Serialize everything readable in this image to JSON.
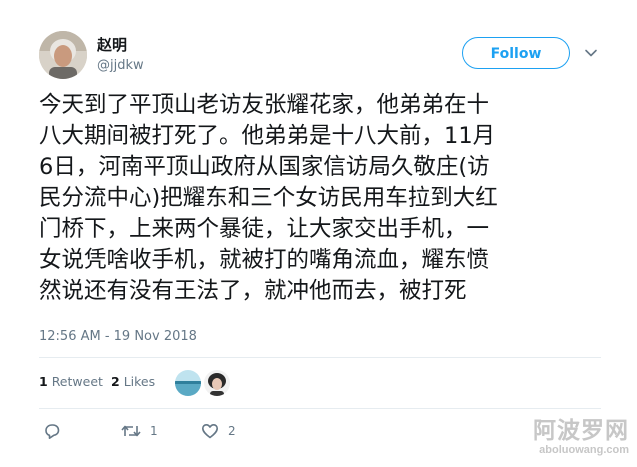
{
  "user": {
    "display_name": "赵明",
    "handle": "@jjdkw",
    "avatar_icon": "profile-photo"
  },
  "follow_button": {
    "label": "Follow"
  },
  "menu_icon": "chevron-down-icon",
  "tweet": {
    "lines": [
      "今天到了平顶山老访友张耀花家，他弟弟在十",
      "八大期间被打死了。他弟弟是十八大前，11月",
      "6日，河南平顶山政府从国家信访局久敬庄(访",
      "民分流中心)把耀东和三个女访民用车拉到大红",
      "门桥下，上来两个暴徒，让大家交出手机，一",
      "女说凭啥收手机，就被打的嘴角流血，耀东愤",
      "然说还有没有王法了，就冲他而去，被打死"
    ],
    "timestamp": "12:56 AM - 19 Nov 2018"
  },
  "stats": {
    "retweets_count": "1",
    "retweets_label": "Retweet",
    "likes_count": "2",
    "likes_label": "Likes"
  },
  "actions": {
    "reply_icon": "reply-icon",
    "retweet_icon": "retweet-icon",
    "retweet_count": "1",
    "like_icon": "heart-icon",
    "like_count": "2"
  },
  "watermark": {
    "chinese": "阿波罗网",
    "domain": "aboluowang.com"
  },
  "colors": {
    "accent": "#1da1f2",
    "secondary_text": "#657786",
    "divider": "#e6ecf0"
  }
}
